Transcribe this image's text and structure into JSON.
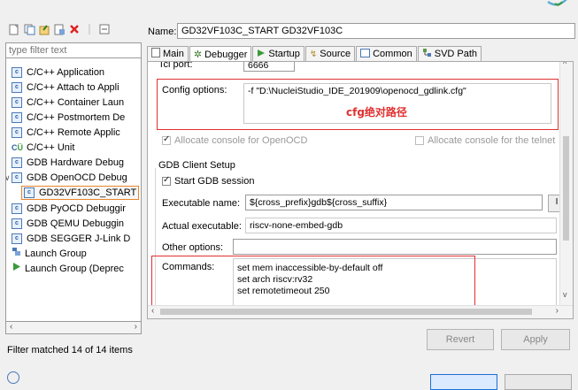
{
  "toolbar": {
    "icons": [
      "new-config-icon",
      "duplicate-icon",
      "export-icon",
      "import-icon",
      "delete-icon",
      "collapse-all-icon"
    ]
  },
  "filter": {
    "placeholder": "type filter text"
  },
  "tree": {
    "items": [
      {
        "label": "C/C++ Application"
      },
      {
        "label": "C/C++ Attach to Appli"
      },
      {
        "label": "C/C++ Container Laun"
      },
      {
        "label": "C/C++ Postmortem De"
      },
      {
        "label": "C/C++ Remote Applic"
      },
      {
        "label": "C/C++ Unit"
      },
      {
        "label": "GDB Hardware Debug"
      },
      {
        "label": "GDB OpenOCD Debug"
      },
      {
        "label": "GD32VF103C_START"
      },
      {
        "label": "GDB PyOCD Debuggir"
      },
      {
        "label": "GDB QEMU Debuggin"
      },
      {
        "label": "GDB SEGGER J-Link D"
      },
      {
        "label": "Launch Group"
      },
      {
        "label": "Launch Group (Deprec"
      }
    ],
    "expand_glyph": "∨"
  },
  "status": {
    "text": "Filter matched 14 of 14 items"
  },
  "name": {
    "label": "Name:",
    "value": "GD32VF103C_START GD32VF103C"
  },
  "tabs": [
    {
      "label": "Main"
    },
    {
      "label": "Debugger"
    },
    {
      "label": "Startup"
    },
    {
      "label": "Source"
    },
    {
      "label": "Common"
    },
    {
      "label": "SVD Path"
    }
  ],
  "form": {
    "tcl_port_label": "Tcl port:",
    "tcl_port_value": "6666",
    "config_label": "Config options:",
    "config_value": "-f \"D:\\NucleiStudio_IDE_201909\\openocd_gdlink.cfg\"",
    "config_annotation": "cfg绝对路径",
    "alloc_openocd": "Allocate console for OpenOCD",
    "alloc_telnet": "Allocate console for the telnet",
    "gdb_section": "GDB Client Setup",
    "start_gdb": "Start GDB session",
    "exec_label": "Executable name:",
    "exec_value": "${cross_prefix}gdb${cross_suffix}",
    "actual_label": "Actual executable:",
    "actual_value": "riscv-none-embed-gdb",
    "other_label": "Other options:",
    "other_value": "",
    "commands_label": "Commands:",
    "commands": [
      "set mem inaccessible-by-default off",
      "set arch riscv:rv32",
      "set remotetimeout 250"
    ]
  },
  "buttons": {
    "revert": "Revert",
    "apply": "Apply"
  },
  "colors": {
    "annotation_red": "#e03030",
    "selection_border": "#e8852d",
    "tree_icon_blue": "#2b5fa8",
    "primary_button": "#1d6dd8"
  }
}
